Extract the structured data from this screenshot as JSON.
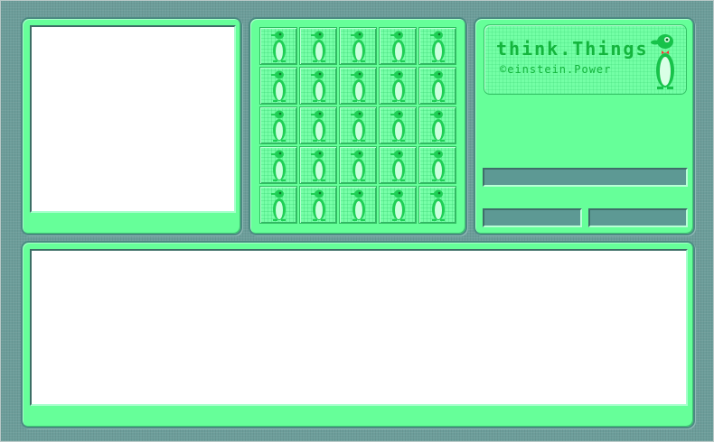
{
  "app": {
    "logo_title": "think.Things",
    "logo_subtitle": "©einstein.Power"
  },
  "grid": {
    "rows": 5,
    "cols": 5,
    "tile_icon": "penguin-icon"
  },
  "colors": {
    "panel": "#66ff99",
    "background": "#6c9d9a",
    "accent": "#14b53d",
    "bar": "#5d9994",
    "screen": "#ffffff",
    "bowtie": "#ff3333"
  }
}
